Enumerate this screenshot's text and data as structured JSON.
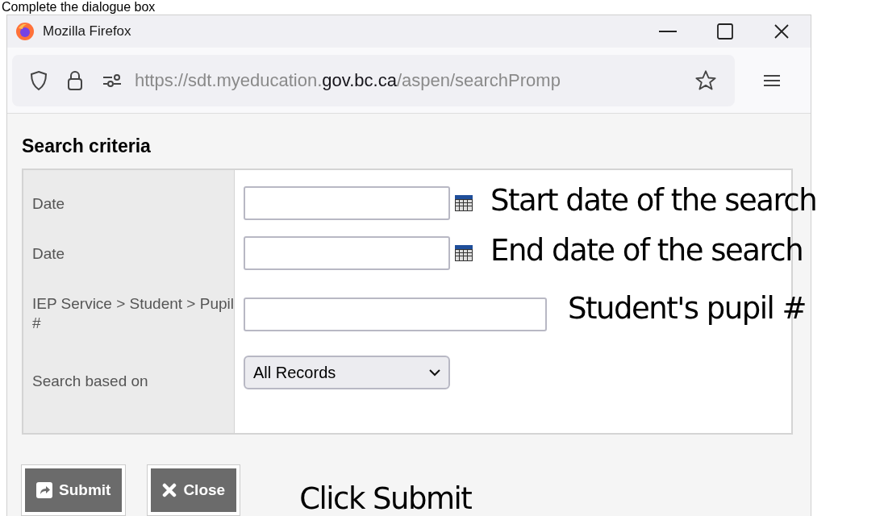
{
  "caption": "Complete the dialogue box",
  "window": {
    "title": "Mozilla Firefox"
  },
  "address_bar": {
    "url_start": "https://sdt.myeducation.",
    "url_domain": "gov.bc.ca",
    "url_end": "/aspen/searchPromp"
  },
  "heading": "Search criteria",
  "fields": [
    {
      "kind": "date",
      "label": "Date",
      "note": "Start date of the search"
    },
    {
      "kind": "date",
      "label": "Date",
      "note": "End date of the search"
    },
    {
      "kind": "text",
      "label": "IEP Service > Student > Pupil #",
      "note": "Student's pupil #"
    },
    {
      "kind": "select",
      "label": "Search based on",
      "value": "All Records"
    }
  ],
  "buttons": [
    {
      "kind": "submit",
      "label": "Submit"
    },
    {
      "kind": "close",
      "label": "Close"
    }
  ],
  "footer_note": "Click Submit"
}
